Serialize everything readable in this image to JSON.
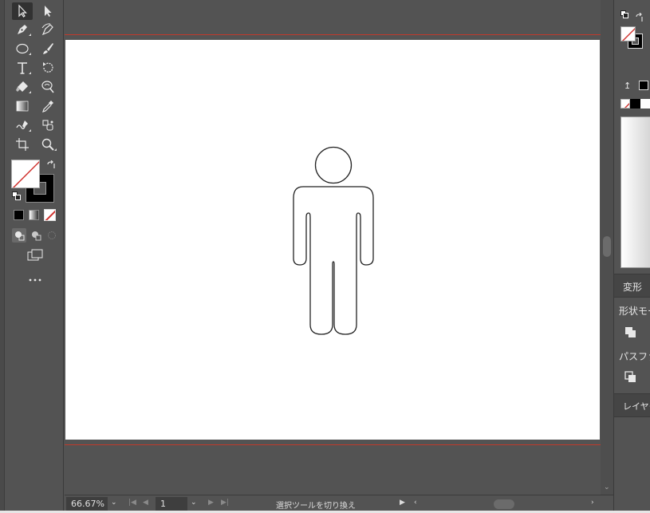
{
  "statusbar": {
    "zoom_value": "66.67%",
    "artboard_number": "1",
    "status_message": "選択ツールを切り換え"
  },
  "right_panel": {
    "transform_tab_label": "変形",
    "shape_modes_label": "形状モー",
    "pathfinder_label": "パスファ",
    "layers_tab_label": "レイヤー"
  },
  "colors": {
    "accent_red": "#c0392b",
    "artboard": "#ffffff",
    "ui_background": "#535353"
  },
  "toolbar": {
    "tools": [
      "selection-tool",
      "direct-selection-tool",
      "pen-tool",
      "curvature-tool",
      "ellipse-tool",
      "paintbrush-tool",
      "type-tool",
      "rotate-tool",
      "eraser-tool",
      "warp-tool",
      "gradient-tool",
      "eyedropper-tool",
      "shaper-tool",
      "symbol-sprayer-tool",
      "artboard-tool",
      "zoom-tool"
    ],
    "more_tools_icon": "more-dots-icon"
  }
}
